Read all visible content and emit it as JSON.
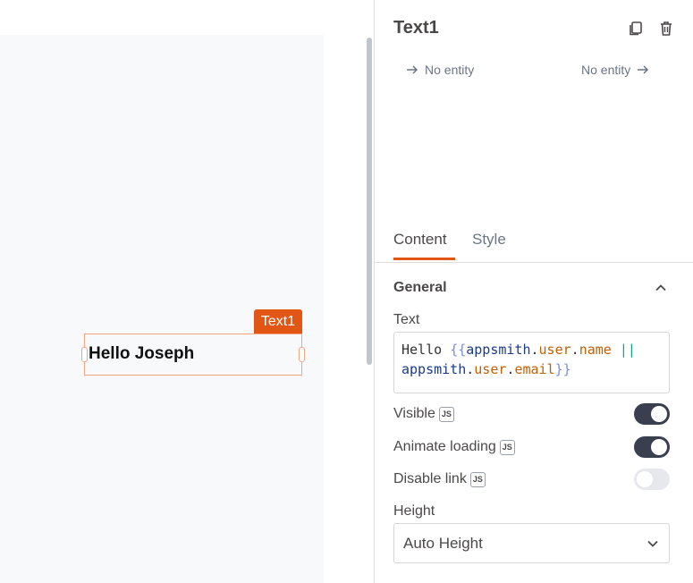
{
  "canvas": {
    "widget_tag": "Text1",
    "widget_text": "Hello Joseph"
  },
  "panel": {
    "title": "Text1",
    "entity_left": "No entity",
    "entity_right": "No entity",
    "tabs": [
      {
        "label": "Content",
        "active": true
      },
      {
        "label": "Style",
        "active": false
      }
    ],
    "section_title": "General",
    "text_label": "Text",
    "text_code": {
      "line1_prefix": "Hello ",
      "open": "{{",
      "obj1": "appsmith",
      "dot": ".",
      "p1": "user",
      "p2": "name",
      "or": "||",
      "obj2": "appsmith",
      "p3": "user",
      "p4": "email",
      "close": "}}"
    },
    "js_badge": "JS",
    "toggles": [
      {
        "label": "Visible",
        "on": true
      },
      {
        "label": "Animate loading",
        "on": true
      },
      {
        "label": "Disable link",
        "on": false
      }
    ],
    "height_label": "Height",
    "height_value": "Auto Height"
  },
  "colors": {
    "accent": "#e15615",
    "toggle_on": "#393f4f",
    "toggle_off": "#e6e8ec"
  },
  "icons": [
    "copy-icon",
    "trash-icon",
    "arrow-right-icon",
    "chevron-up-icon",
    "chevron-down-icon"
  ]
}
